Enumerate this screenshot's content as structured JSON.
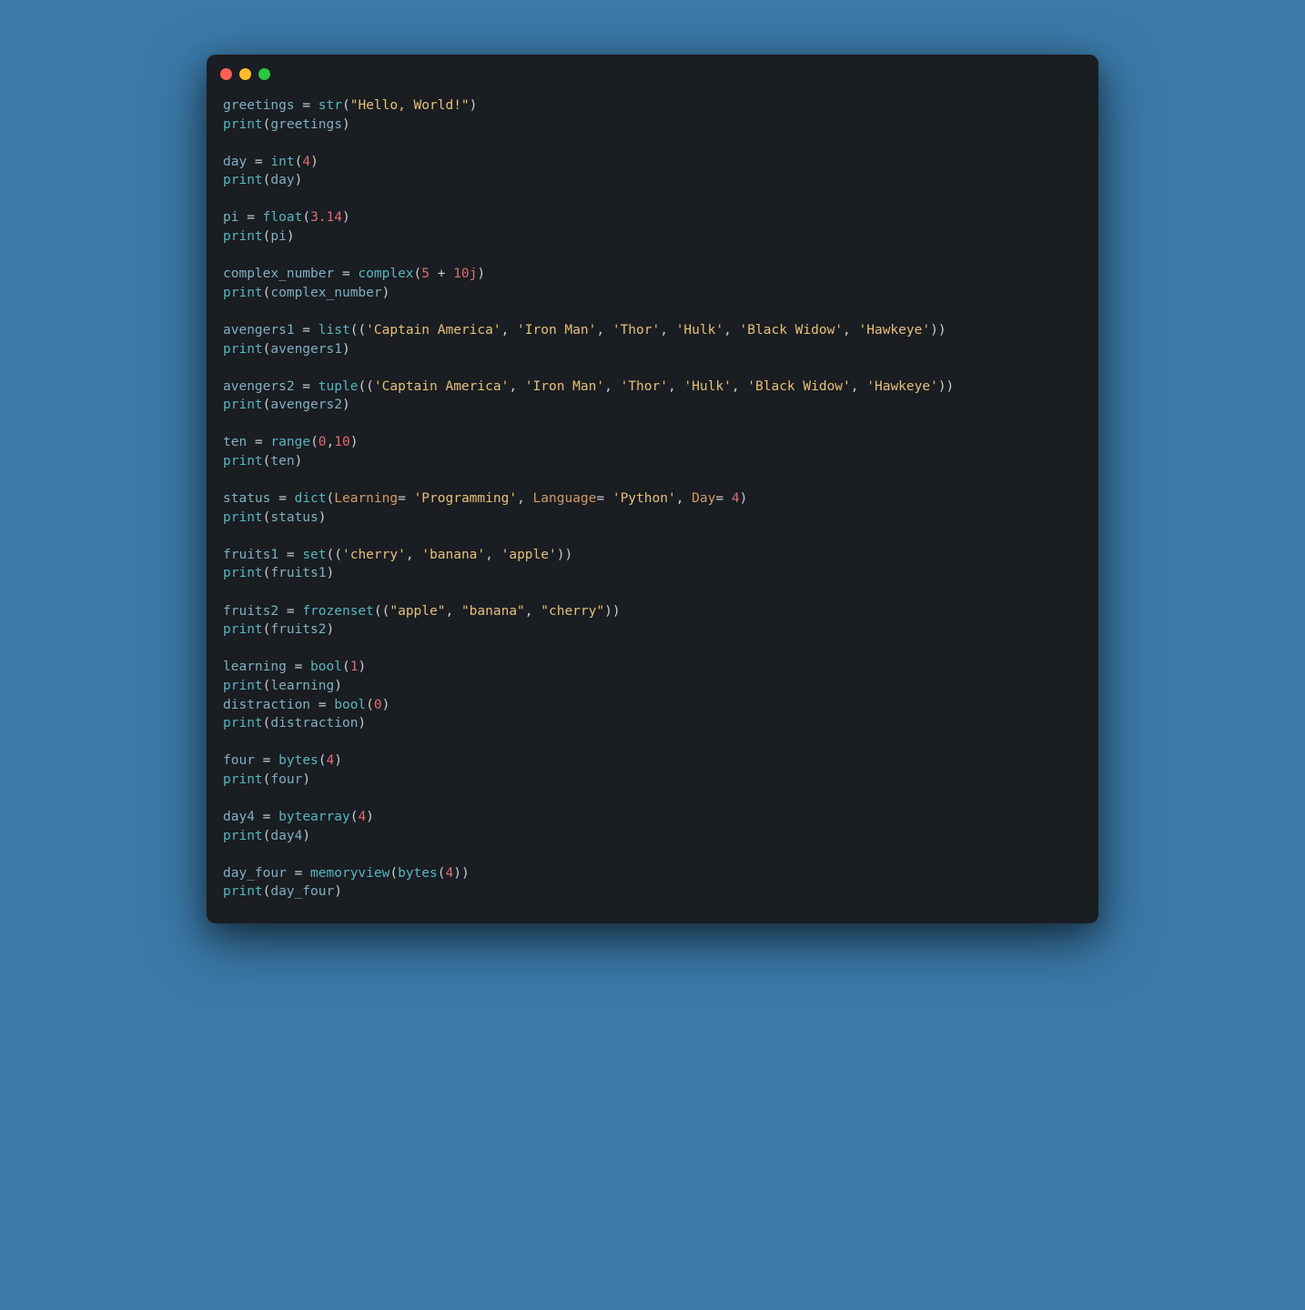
{
  "colors": {
    "background": "#3b79a8",
    "editor_bg": "#1a1d21",
    "dot_red": "#ff5f57",
    "dot_yellow": "#febc2e",
    "dot_green": "#28c840",
    "function": "#56b6c2",
    "variable": "#7fb0c4",
    "punctuation": "#c8cdd3",
    "string": "#e5c07b",
    "number": "#e06c75",
    "argname": "#d19a66"
  },
  "tokens": [
    [
      [
        "var",
        "greetings"
      ],
      [
        "pun",
        " = "
      ],
      [
        "fn",
        "str"
      ],
      [
        "pun",
        "("
      ],
      [
        "str",
        "\"Hello, World!\""
      ],
      [
        "pun",
        ")"
      ]
    ],
    [
      [
        "fn",
        "print"
      ],
      [
        "pun",
        "("
      ],
      [
        "var",
        "greetings"
      ],
      [
        "pun",
        ")"
      ]
    ],
    [],
    [
      [
        "var",
        "day"
      ],
      [
        "pun",
        " = "
      ],
      [
        "fn",
        "int"
      ],
      [
        "pun",
        "("
      ],
      [
        "num",
        "4"
      ],
      [
        "pun",
        ")"
      ]
    ],
    [
      [
        "fn",
        "print"
      ],
      [
        "pun",
        "("
      ],
      [
        "var",
        "day"
      ],
      [
        "pun",
        ")"
      ]
    ],
    [],
    [
      [
        "var",
        "pi"
      ],
      [
        "pun",
        " = "
      ],
      [
        "fn",
        "float"
      ],
      [
        "pun",
        "("
      ],
      [
        "num",
        "3.14"
      ],
      [
        "pun",
        ")"
      ]
    ],
    [
      [
        "fn",
        "print"
      ],
      [
        "pun",
        "("
      ],
      [
        "var",
        "pi"
      ],
      [
        "pun",
        ")"
      ]
    ],
    [],
    [
      [
        "var",
        "complex_number"
      ],
      [
        "pun",
        " = "
      ],
      [
        "fn",
        "complex"
      ],
      [
        "pun",
        "("
      ],
      [
        "num",
        "5"
      ],
      [
        "pun",
        " + "
      ],
      [
        "num",
        "10j"
      ],
      [
        "pun",
        ")"
      ]
    ],
    [
      [
        "fn",
        "print"
      ],
      [
        "pun",
        "("
      ],
      [
        "var",
        "complex_number"
      ],
      [
        "pun",
        ")"
      ]
    ],
    [],
    [
      [
        "var",
        "avengers1"
      ],
      [
        "pun",
        " = "
      ],
      [
        "fn",
        "list"
      ],
      [
        "pun",
        "(("
      ],
      [
        "str",
        "'Captain America'"
      ],
      [
        "pun",
        ", "
      ],
      [
        "str",
        "'Iron Man'"
      ],
      [
        "pun",
        ", "
      ],
      [
        "str",
        "'Thor'"
      ],
      [
        "pun",
        ", "
      ],
      [
        "str",
        "'Hulk'"
      ],
      [
        "pun",
        ", "
      ],
      [
        "str",
        "'Black Widow'"
      ],
      [
        "pun",
        ", "
      ],
      [
        "str",
        "'Hawkeye'"
      ],
      [
        "pun",
        "))"
      ]
    ],
    [
      [
        "fn",
        "print"
      ],
      [
        "pun",
        "("
      ],
      [
        "var",
        "avengers1"
      ],
      [
        "pun",
        ")"
      ]
    ],
    [],
    [
      [
        "var",
        "avengers2"
      ],
      [
        "pun",
        " = "
      ],
      [
        "fn",
        "tuple"
      ],
      [
        "pun",
        "(("
      ],
      [
        "str",
        "'Captain America'"
      ],
      [
        "pun",
        ", "
      ],
      [
        "str",
        "'Iron Man'"
      ],
      [
        "pun",
        ", "
      ],
      [
        "str",
        "'Thor'"
      ],
      [
        "pun",
        ", "
      ],
      [
        "str",
        "'Hulk'"
      ],
      [
        "pun",
        ", "
      ],
      [
        "str",
        "'Black Widow'"
      ],
      [
        "pun",
        ", "
      ],
      [
        "str",
        "'Hawkeye'"
      ],
      [
        "pun",
        "))"
      ]
    ],
    [
      [
        "fn",
        "print"
      ],
      [
        "pun",
        "("
      ],
      [
        "var",
        "avengers2"
      ],
      [
        "pun",
        ")"
      ]
    ],
    [],
    [
      [
        "var",
        "ten"
      ],
      [
        "pun",
        " = "
      ],
      [
        "fn",
        "range"
      ],
      [
        "pun",
        "("
      ],
      [
        "num",
        "0"
      ],
      [
        "pun",
        ","
      ],
      [
        "num",
        "10"
      ],
      [
        "pun",
        ")"
      ]
    ],
    [
      [
        "fn",
        "print"
      ],
      [
        "pun",
        "("
      ],
      [
        "var",
        "ten"
      ],
      [
        "pun",
        ")"
      ]
    ],
    [],
    [
      [
        "var",
        "status"
      ],
      [
        "pun",
        " = "
      ],
      [
        "fn",
        "dict"
      ],
      [
        "pun",
        "("
      ],
      [
        "arg",
        "Learning"
      ],
      [
        "pun",
        "= "
      ],
      [
        "str",
        "'Programming'"
      ],
      [
        "pun",
        ", "
      ],
      [
        "arg",
        "Language"
      ],
      [
        "pun",
        "= "
      ],
      [
        "str",
        "'Python'"
      ],
      [
        "pun",
        ", "
      ],
      [
        "arg",
        "Day"
      ],
      [
        "pun",
        "= "
      ],
      [
        "num",
        "4"
      ],
      [
        "pun",
        ")"
      ]
    ],
    [
      [
        "fn",
        "print"
      ],
      [
        "pun",
        "("
      ],
      [
        "var",
        "status"
      ],
      [
        "pun",
        ")"
      ]
    ],
    [],
    [
      [
        "var",
        "fruits1"
      ],
      [
        "pun",
        " = "
      ],
      [
        "fn",
        "set"
      ],
      [
        "pun",
        "(("
      ],
      [
        "str",
        "'cherry'"
      ],
      [
        "pun",
        ", "
      ],
      [
        "str",
        "'banana'"
      ],
      [
        "pun",
        ", "
      ],
      [
        "str",
        "'apple'"
      ],
      [
        "pun",
        "))"
      ]
    ],
    [
      [
        "fn",
        "print"
      ],
      [
        "pun",
        "("
      ],
      [
        "var",
        "fruits1"
      ],
      [
        "pun",
        ")"
      ]
    ],
    [],
    [
      [
        "var",
        "fruits2"
      ],
      [
        "pun",
        " = "
      ],
      [
        "fn",
        "frozenset"
      ],
      [
        "pun",
        "(("
      ],
      [
        "str",
        "\"apple\""
      ],
      [
        "pun",
        ", "
      ],
      [
        "str",
        "\"banana\""
      ],
      [
        "pun",
        ", "
      ],
      [
        "str",
        "\"cherry\""
      ],
      [
        "pun",
        "))"
      ]
    ],
    [
      [
        "fn",
        "print"
      ],
      [
        "pun",
        "("
      ],
      [
        "var",
        "fruits2"
      ],
      [
        "pun",
        ")"
      ]
    ],
    [],
    [
      [
        "var",
        "learning"
      ],
      [
        "pun",
        " = "
      ],
      [
        "fn",
        "bool"
      ],
      [
        "pun",
        "("
      ],
      [
        "num",
        "1"
      ],
      [
        "pun",
        ")"
      ]
    ],
    [
      [
        "fn",
        "print"
      ],
      [
        "pun",
        "("
      ],
      [
        "var",
        "learning"
      ],
      [
        "pun",
        ")"
      ]
    ],
    [
      [
        "var",
        "distraction"
      ],
      [
        "pun",
        " = "
      ],
      [
        "fn",
        "bool"
      ],
      [
        "pun",
        "("
      ],
      [
        "num",
        "0"
      ],
      [
        "pun",
        ")"
      ]
    ],
    [
      [
        "fn",
        "print"
      ],
      [
        "pun",
        "("
      ],
      [
        "var",
        "distraction"
      ],
      [
        "pun",
        ")"
      ]
    ],
    [],
    [
      [
        "var",
        "four"
      ],
      [
        "pun",
        " = "
      ],
      [
        "fn",
        "bytes"
      ],
      [
        "pun",
        "("
      ],
      [
        "num",
        "4"
      ],
      [
        "pun",
        ")"
      ]
    ],
    [
      [
        "fn",
        "print"
      ],
      [
        "pun",
        "("
      ],
      [
        "var",
        "four"
      ],
      [
        "pun",
        ")"
      ]
    ],
    [],
    [
      [
        "var",
        "day4"
      ],
      [
        "pun",
        " = "
      ],
      [
        "fn",
        "bytearray"
      ],
      [
        "pun",
        "("
      ],
      [
        "num",
        "4"
      ],
      [
        "pun",
        ")"
      ]
    ],
    [
      [
        "fn",
        "print"
      ],
      [
        "pun",
        "("
      ],
      [
        "var",
        "day4"
      ],
      [
        "pun",
        ")"
      ]
    ],
    [],
    [
      [
        "var",
        "day_four"
      ],
      [
        "pun",
        " = "
      ],
      [
        "fn",
        "memoryview"
      ],
      [
        "pun",
        "("
      ],
      [
        "fn",
        "bytes"
      ],
      [
        "pun",
        "("
      ],
      [
        "num",
        "4"
      ],
      [
        "pun",
        "))"
      ]
    ],
    [
      [
        "fn",
        "print"
      ],
      [
        "pun",
        "("
      ],
      [
        "var",
        "day_four"
      ],
      [
        "pun",
        ")"
      ]
    ]
  ]
}
